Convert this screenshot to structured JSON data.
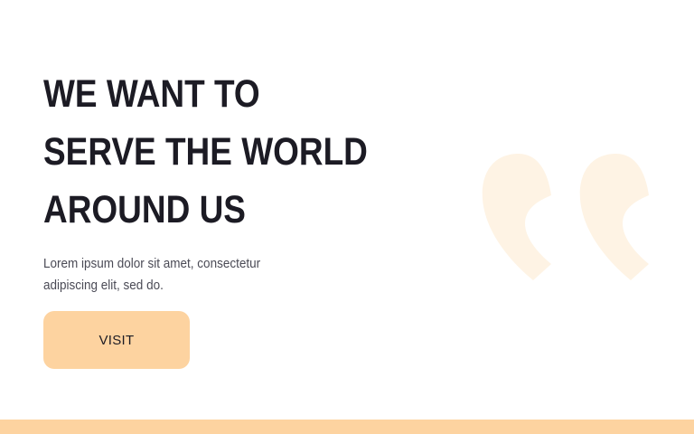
{
  "hero": {
    "headline_lines": [
      "WE WANT TO",
      "SERVE THE WORLD",
      "AROUND US"
    ],
    "body_lines": [
      "Lorem ipsum dolor sit amet, consectetur",
      "adipiscing elit, sed do."
    ],
    "button_label": "VISIT"
  },
  "decor": {
    "quote_icon": "quote-icon",
    "accent_color": "#fdd3a0",
    "quote_color": "#fef3e4",
    "text_color": "#1c1b24"
  }
}
